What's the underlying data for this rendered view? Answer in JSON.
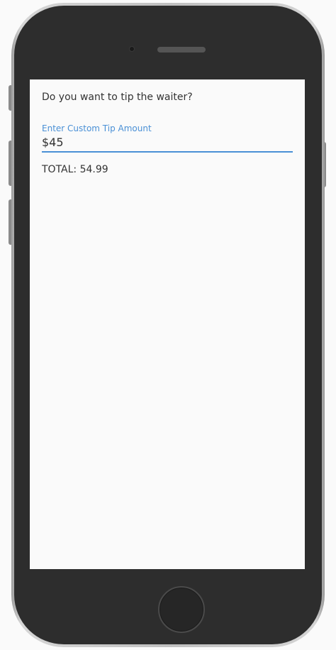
{
  "screen": {
    "question": "Do you want to tip the waiter?",
    "tip_field": {
      "label": "Enter Custom Tip Amount",
      "value": "$45"
    },
    "total_text": "TOTAL: 54.99"
  },
  "colors": {
    "accent": "#4a90d6",
    "text": "#333333",
    "screen_background": "#fafafa",
    "device_body": "#2d2d2d"
  }
}
